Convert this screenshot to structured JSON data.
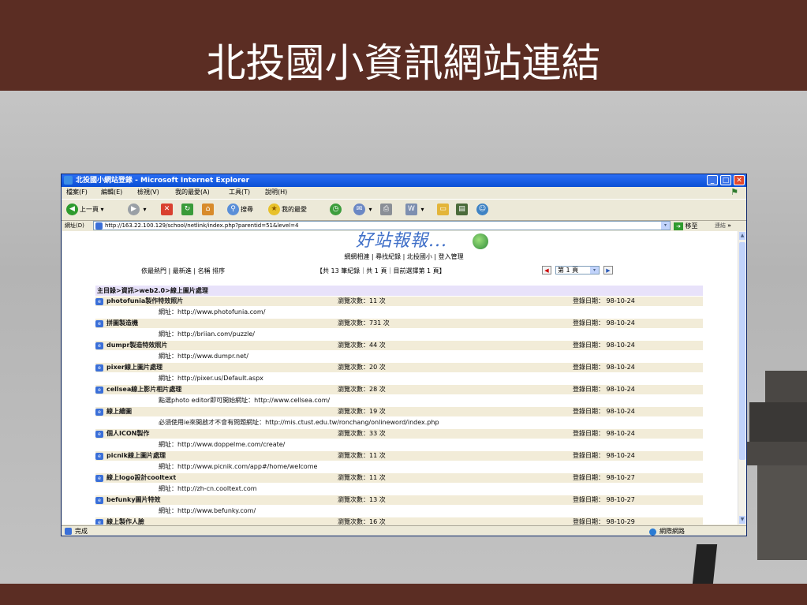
{
  "slide": {
    "title": "北投國小資訊網站連結"
  },
  "window": {
    "title": "北投國小網站登錄 - Microsoft Internet Explorer",
    "menu": [
      "檔案(F)",
      "編輯(E)",
      "檢視(V)",
      "我的最愛(A)",
      "工具(T)",
      "說明(H)"
    ],
    "toolbar": {
      "back": "上一頁",
      "search": "搜尋",
      "favorites": "我的最愛"
    },
    "address_label": "網址(D)",
    "address": "http://163.22.100.129/school/netlink/index.php?parentid=51&level=4",
    "go_label": "移至",
    "links_label": "連結",
    "status_left": "完成",
    "status_right": "網際網路"
  },
  "page": {
    "logo": "好站報報...",
    "nav": [
      "網網相連",
      "尋找紀錄",
      "北投國小",
      "登入管理"
    ],
    "sort": [
      "依最熱門",
      "最新進",
      "名稱 排序"
    ],
    "count_info": "【共 13 筆紀錄｜共 1 頁｜目前選擇第 1 頁】",
    "page_select": "第 1 頁",
    "breadcrumb": "主目錄>資訊>web2.0>線上圖片處理",
    "entries": [
      {
        "name": "photofunia製作特效照片",
        "views": "瀏覽次數：11 次",
        "date": "登錄日期： 98-10-24",
        "url": "網址：http://www.photofunia.com/"
      },
      {
        "name": "拼圖製造機",
        "views": "瀏覽次數：731 次",
        "date": "登錄日期： 98-10-24",
        "url": "網址：http://briian.com/puzzle/"
      },
      {
        "name": "dumpr製造特效照片",
        "views": "瀏覽次數：44 次",
        "date": "登錄日期： 98-10-24",
        "url": "網址：http://www.dumpr.net/"
      },
      {
        "name": "pixer線上圖片處理",
        "views": "瀏覽次數：20 次",
        "date": "登錄日期： 98-10-24",
        "url": "網址：http://pixer.us/Default.aspx"
      },
      {
        "name": "cellsea線上影片相片處理",
        "views": "瀏覽次數：28 次",
        "date": "登錄日期： 98-10-24",
        "url": "點選photo editor即可開始網址：http://www.cellsea.com/"
      },
      {
        "name": "線上繪圖",
        "views": "瀏覽次數：19 次",
        "date": "登錄日期： 98-10-24",
        "url": "必須使用ie來開啟才不會有問題網址：http://mis.ctust.edu.tw/ronchang/onlineword/index.php"
      },
      {
        "name": "個人ICON製作",
        "views": "瀏覽次數：33 次",
        "date": "登錄日期： 98-10-24",
        "url": "網址：http://www.doppelme.com/create/"
      },
      {
        "name": "picnik線上圖片處理",
        "views": "瀏覽次數：11 次",
        "date": "登錄日期： 98-10-24",
        "url": "網址：http://www.picnik.com/app#/home/welcome"
      },
      {
        "name": "線上logo設計cooltext",
        "views": "瀏覽次數：11 次",
        "date": "登錄日期： 98-10-27",
        "url": "網址：http://zh-cn.cooltext.com"
      },
      {
        "name": "befunky圖片特效",
        "views": "瀏覽次數：13 次",
        "date": "登錄日期： 98-10-27",
        "url": "網址：http://www.befunky.com/"
      },
      {
        "name": "線上製作人臉",
        "views": "瀏覽次數：16 次",
        "date": "登錄日期： 98-10-29",
        "url": ""
      }
    ]
  },
  "colors": {
    "band": "#5b2d23",
    "titlebar": "#0a4fd4",
    "row_bg": "#f2ecd8",
    "breadcrumb_bg": "#e8e2fa"
  }
}
